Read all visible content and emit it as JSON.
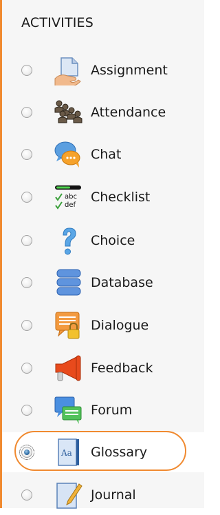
{
  "panel": {
    "title": "ACTIVITIES",
    "items": [
      {
        "label": "Assignment",
        "icon": "assignment-icon",
        "selected": false
      },
      {
        "label": "Attendance",
        "icon": "attendance-icon",
        "selected": false
      },
      {
        "label": "Chat",
        "icon": "chat-icon",
        "selected": false
      },
      {
        "label": "Checklist",
        "icon": "checklist-icon",
        "icon_text": [
          "abc",
          "def"
        ],
        "selected": false
      },
      {
        "label": "Choice",
        "icon": "choice-icon",
        "selected": false
      },
      {
        "label": "Database",
        "icon": "database-icon",
        "selected": false
      },
      {
        "label": "Dialogue",
        "icon": "dialogue-icon",
        "selected": false
      },
      {
        "label": "Feedback",
        "icon": "feedback-icon",
        "selected": false
      },
      {
        "label": "Forum",
        "icon": "forum-icon",
        "selected": false
      },
      {
        "label": "Glossary",
        "icon": "glossary-icon",
        "icon_text": "Aa",
        "selected": true
      },
      {
        "label": "Journal",
        "icon": "journal-icon",
        "selected": false
      }
    ]
  },
  "colors": {
    "accent": "#f08a30",
    "panel_background": "#f6f6f6",
    "selected_background": "#ffffff"
  }
}
